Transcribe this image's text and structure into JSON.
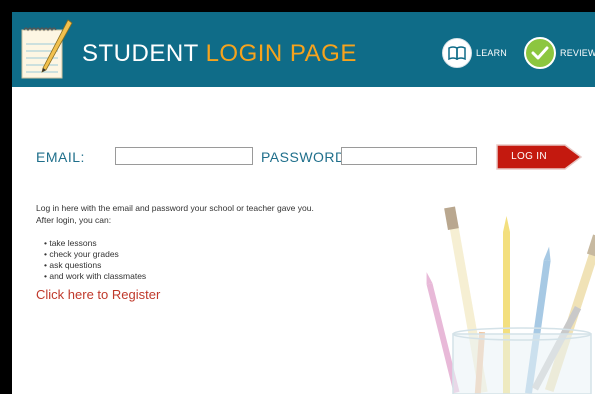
{
  "header": {
    "title_part1": "STUDENT",
    "title_part2": "LOGIN PAGE",
    "logo_icon": "notepad-pencil-icon",
    "nav": [
      {
        "label": "LEARN",
        "icon": "open-book-icon"
      },
      {
        "label": "REVIEW",
        "icon": "checkmark-icon"
      }
    ]
  },
  "form": {
    "email_label": "EMAIL:",
    "password_label": "PASSWORD",
    "email_value": "",
    "password_value": "",
    "login_label": "LOG IN"
  },
  "info": {
    "intro_line1": "Log in here with the email and password your school or teacher gave you.",
    "intro_line2": "After login, you can:",
    "bullets": [
      "• take lessons",
      "• check your grades",
      "• ask questions",
      "• and work with classmates"
    ],
    "register_link": "Click here to Register"
  },
  "colors": {
    "header_bg": "#0f6c88",
    "accent_orange": "#f6a31d",
    "label_teal": "#1f6f8b",
    "button_red": "#c4190f",
    "register_red": "#c0392b",
    "review_green": "#8cc63f"
  }
}
